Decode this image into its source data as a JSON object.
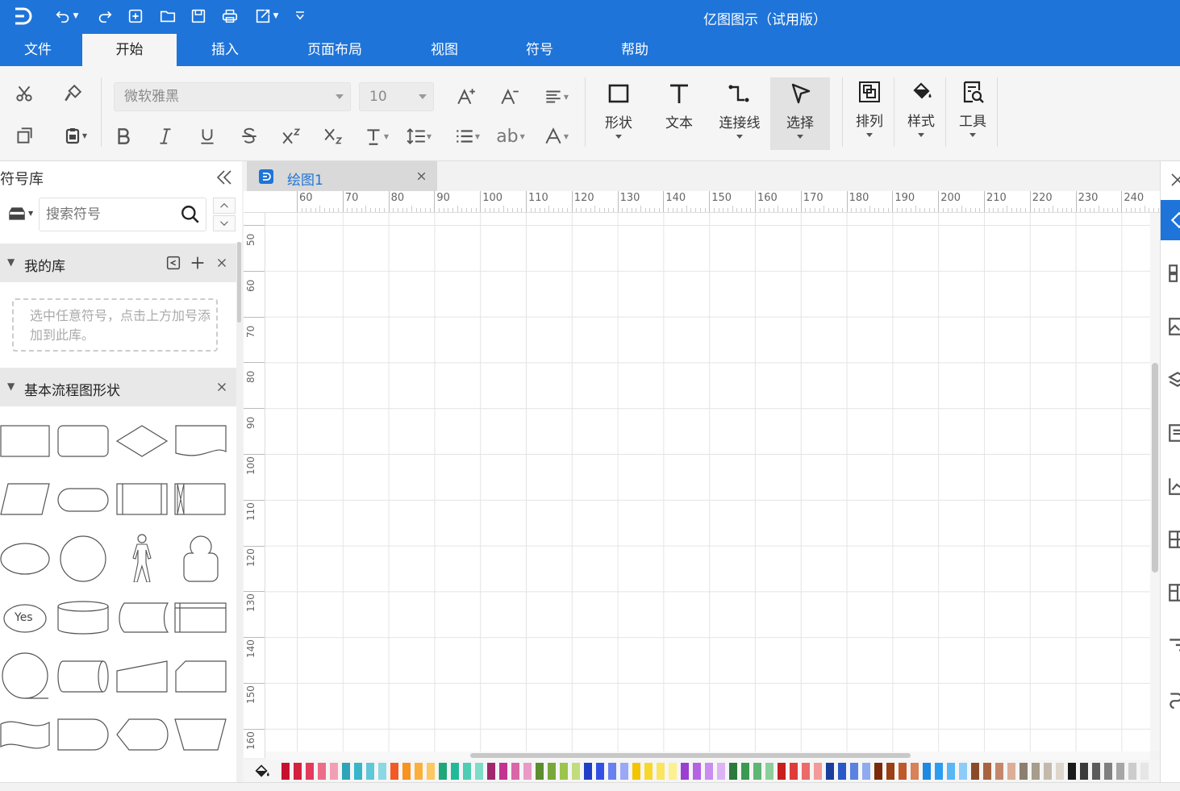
{
  "app": {
    "title": "亿图图示（试用版）"
  },
  "menu": {
    "tabs": [
      "文件",
      "开始",
      "插入",
      "页面布局",
      "视图",
      "符号",
      "帮助"
    ],
    "active": "开始"
  },
  "ribbon": {
    "font_family": "微软雅黑",
    "font_size": "10",
    "big_buttons": {
      "shape": "形状",
      "text": "文本",
      "connector": "连接线",
      "select": "选择",
      "arrange": "排列",
      "style": "样式",
      "tools": "工具"
    },
    "small_text_ab": "ab"
  },
  "sidebar": {
    "title": "符号库",
    "search_placeholder": "搜索符号",
    "my_library": {
      "name": "我的库",
      "hint": "选中任意符号，点击上方加号添加到此库。"
    },
    "flowchart_group": {
      "name": "基本流程图形状",
      "yes_label": "Yes"
    }
  },
  "document": {
    "tab_name": "绘图1"
  },
  "rulers": {
    "horizontal": [
      "60",
      "70",
      "80",
      "90",
      "100",
      "110",
      "120",
      "130",
      "140",
      "150",
      "160",
      "170",
      "180",
      "190",
      "200",
      "210",
      "220",
      "230",
      "240"
    ],
    "vertical": [
      "50",
      "60",
      "70",
      "80",
      "90",
      "100",
      "110",
      "120",
      "130",
      "140",
      "150",
      "160"
    ]
  },
  "palette": {
    "colors": [
      "#c8102e",
      "#d4213d",
      "#e23b5c",
      "#ec6d8a",
      "#f29fb5",
      "#2ea4b8",
      "#38b5c9",
      "#5ec8d8",
      "#8ad8e4",
      "#f15a24",
      "#f7931e",
      "#fbb03b",
      "#fcc85f",
      "#1fa77a",
      "#22b99a",
      "#4dcdb3",
      "#7edcc8",
      "#a1276f",
      "#c2348f",
      "#d966a8",
      "#e99ac6",
      "#5c8d2e",
      "#78a83a",
      "#9cc54d",
      "#c1dc7c",
      "#1f3ec7",
      "#3251e4",
      "#6a7ff0",
      "#9aa8f5",
      "#f2c500",
      "#f8d72b",
      "#fbe55c",
      "#fdf08e",
      "#9b3fd1",
      "#b463e4",
      "#c98cef",
      "#dcb3f5",
      "#2a7a3b",
      "#3a9a4f",
      "#5fb673",
      "#8ccf9b",
      "#c81e1e",
      "#e03b3b",
      "#ec6a6a",
      "#f39a9a",
      "#1b3d9c",
      "#2a58c8",
      "#5a82e0",
      "#8eabef",
      "#7a2a0a",
      "#9b3f14",
      "#c05a2b",
      "#d98158",
      "#1e88e5",
      "#2b9df0",
      "#58b6f5",
      "#8dccf8",
      "#8a4a2a",
      "#a8643f",
      "#c4876a",
      "#dcae97",
      "#8c7f6e",
      "#a89c8b",
      "#c4baab",
      "#ded6cb",
      "#1a1a1a",
      "#3a3a3a",
      "#5c5c5c",
      "#808080",
      "#a6a6a6",
      "#cccccc",
      "#e6e6e6"
    ]
  }
}
